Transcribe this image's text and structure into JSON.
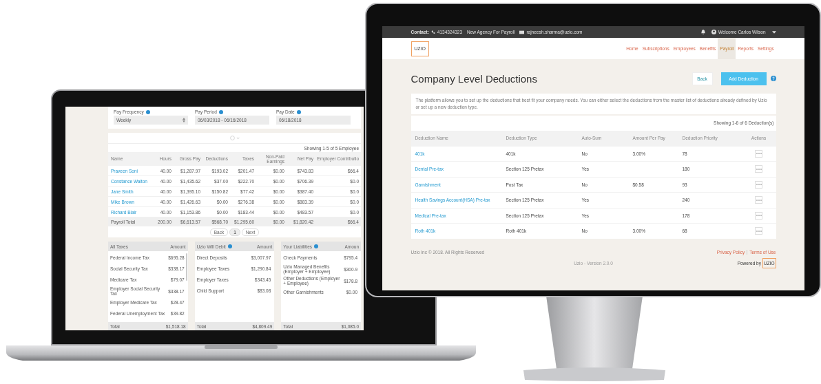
{
  "laptop": {
    "filters": [
      {
        "label": "Pay Frequency",
        "value": "Weekly",
        "kind": "select"
      },
      {
        "label": "Pay Period",
        "value": "06/03/2018 - 06/16/2018",
        "kind": "text"
      },
      {
        "label": "Pay Date",
        "value": "06/18/2018",
        "kind": "text"
      }
    ],
    "showing": "Showing 1-5 of 5 Employee",
    "columns": [
      "Name",
      "Hours",
      "Gross Pay",
      "Deductions",
      "Taxes",
      "Non-Paid Earnings",
      "Net Pay",
      "Employer Contributio"
    ],
    "rows": [
      {
        "cells": [
          "Praveen Soni",
          "40.00",
          "$1,287.97",
          "$193.02",
          "$201.47",
          "$0.00",
          "$743.83",
          "$66.4"
        ]
      },
      {
        "cells": [
          "Constance Walton",
          "40.00",
          "$1,435.62",
          "$37.00",
          "$222.70",
          "$0.00",
          "$706.39",
          "$0.0"
        ]
      },
      {
        "cells": [
          "Jane Smith",
          "40.00",
          "$1,395.10",
          "$150.82",
          "$77.42",
          "$0.00",
          "$387.40",
          "$0.0"
        ]
      },
      {
        "cells": [
          "Mike Brown",
          "40.00",
          "$1,426.63",
          "$0.00",
          "$276.38",
          "$0.00",
          "$883.39",
          "$0.0"
        ]
      },
      {
        "cells": [
          "Richard Blair",
          "40.00",
          "$1,153.86",
          "$0.00",
          "$183.44",
          "$0.00",
          "$483.57",
          "$0.0"
        ]
      }
    ],
    "total_row": [
      "Payroll Total",
      "200.00",
      "$6,613.57",
      "$568.70",
      "$1,295.60",
      "$0.00",
      "$1,820.42",
      "$66.4"
    ],
    "pager": [
      {
        "label": "Back",
        "selected": false
      },
      {
        "label": "1",
        "selected": true
      },
      {
        "label": "Next",
        "selected": false
      }
    ],
    "cards": [
      {
        "title": "All Taxes",
        "help": false,
        "amount_label": "Amount",
        "total_label": "Total",
        "total": "$1,518.18",
        "rows": [
          {
            "label": "Federal Income Tax",
            "value": "$695.28"
          },
          {
            "label": "Social Security Tax",
            "value": "$338.17"
          },
          {
            "label": "Medicare Tax",
            "value": "$79.07"
          },
          {
            "label": "Employer Social Security Tax",
            "value": "$338.17"
          },
          {
            "label": "Employer Medicare Tax",
            "value": "$28.47"
          },
          {
            "label": "Federal Unemployment Tax",
            "value": "$39.82"
          }
        ]
      },
      {
        "title": "Uzio Will Debit",
        "help": true,
        "amount_label": "Amount",
        "total_label": "Total",
        "total": "$4,809.49",
        "rows": [
          {
            "label": "Direct Deposits",
            "value": "$3,007.97"
          },
          {
            "label": "Employee Taxes",
            "value": "$1,290.84"
          },
          {
            "label": "Employer Taxes",
            "value": "$343.45"
          },
          {
            "label": "Child Support",
            "value": "$83.08"
          }
        ]
      },
      {
        "title": "Your Liabilities",
        "help": true,
        "amount_label": "Amoun",
        "total_label": "Total",
        "total": "$1,085.0",
        "rows": [
          {
            "label": "Check Payments",
            "value": "$795.4"
          },
          {
            "label": "Uzio Managed Benefits (Employer + Employee)",
            "value": "$300.9"
          },
          {
            "label": "Other Deductions (Employer + Employee)",
            "value": "$178.8"
          },
          {
            "label": "Other Garnishments",
            "value": "$0.00"
          }
        ]
      }
    ]
  },
  "monitor": {
    "top_bar": {
      "contact_label": "Contact:",
      "phone": "4134324323",
      "agency": "New Agency For Payroll",
      "email": "rajneesh.sharma@uzio.com",
      "welcome": "Welcome Carlos Wilson"
    },
    "logo": "UZIO",
    "nav": [
      {
        "label": "Home",
        "selected": false
      },
      {
        "label": "Subscriptions",
        "selected": false
      },
      {
        "label": "Employees",
        "selected": false
      },
      {
        "label": "Benefits",
        "selected": false
      },
      {
        "label": "Payroll",
        "selected": true
      },
      {
        "label": "Reports",
        "selected": false
      },
      {
        "label": "Settings",
        "selected": false
      }
    ],
    "page_title": "Company Level Deductions",
    "buttons": [
      {
        "label": "Back",
        "kind": "secondary"
      },
      {
        "label": "Add Deduction",
        "kind": "primary"
      }
    ],
    "description": "The platform allows you to set up the deductions that best fit your company needs. You can either select the deductions from the master list of deductions already defined by Uzio or set up a new deduction type.",
    "showing": "Showing 1-6 of 6 Deduction(s)",
    "columns": [
      "Deduction Name",
      "Deduction Type",
      "Auto-Sum",
      "Amount Per Pay",
      "Deduction Priority",
      "Actions"
    ],
    "rows": [
      {
        "name": "401k",
        "type": "401k",
        "auto": "No",
        "amount": "3.00%",
        "priority": "78"
      },
      {
        "name": "Dental Pre-tax",
        "type": "Section 125 Pretax",
        "auto": "Yes",
        "priority": "180"
      },
      {
        "name": "Garnishment",
        "type": "Post Tax",
        "auto": "No",
        "amount": "$0.58",
        "priority": "93"
      },
      {
        "name": "Health Savings Account(HSA) Pre-tax",
        "type": "Section 125 Pretax",
        "auto": "Yes",
        "priority": "240"
      },
      {
        "name": "Medical Pre-tax",
        "type": "Section 125 Pretax",
        "auto": "Yes",
        "priority": "178"
      },
      {
        "name": "Roth 401k",
        "type": "Roth 401k",
        "auto": "No",
        "amount": "3.00%",
        "priority": "68"
      }
    ],
    "footer": {
      "copyright": "Uzio Inc © 2018. All Rights Reserved",
      "version": "Uzio - Version 2.0.0",
      "links": [
        "Privacy Policy",
        "Terms of Use"
      ],
      "powered_by": "Powered by",
      "powered_logo": "UZIO"
    }
  }
}
